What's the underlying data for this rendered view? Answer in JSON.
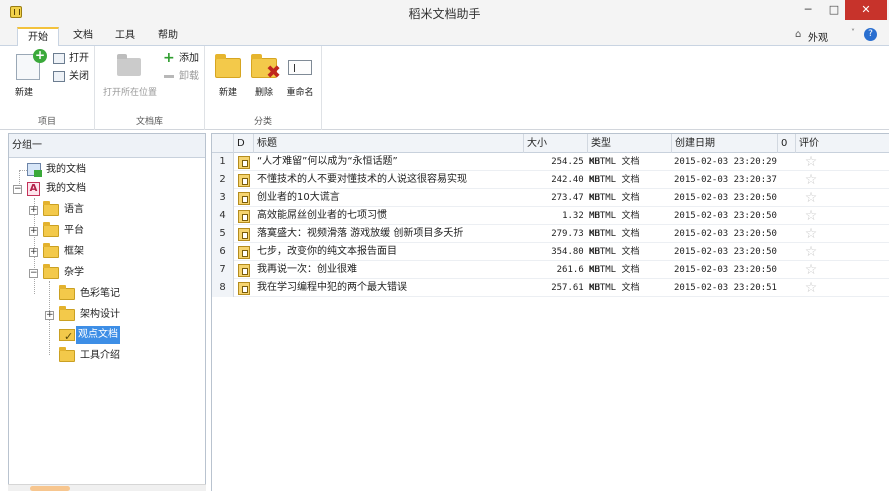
{
  "app": {
    "title": "稻米文档助手"
  },
  "window": {
    "minimize": "─",
    "maximize": "□",
    "close": "✕"
  },
  "tabs": [
    {
      "label": "开始",
      "active": true
    },
    {
      "label": "文档"
    },
    {
      "label": "工具"
    },
    {
      "label": "帮助"
    }
  ],
  "skin": {
    "icon": "⌂",
    "label": "外观",
    "arrow": "˅",
    "help": "?"
  },
  "ribbon": {
    "project": {
      "label": "项目",
      "new": "新建",
      "open": "打开",
      "close": "关闭"
    },
    "library": {
      "label": "文档库",
      "open_location": "打开所在位置",
      "add": "添加",
      "remove": "卸载"
    },
    "category": {
      "label": "分类",
      "new": "新建",
      "delete": "删除",
      "rename": "重命名"
    }
  },
  "tree": {
    "header": "分组一",
    "items": [
      {
        "label": "我的文档"
      },
      {
        "label": "我的文档"
      },
      {
        "label": "语言"
      },
      {
        "label": "平台"
      },
      {
        "label": "框架"
      },
      {
        "label": "杂学"
      },
      {
        "label": "色彩笔记"
      },
      {
        "label": "架构设计"
      },
      {
        "label": "观点文档",
        "selected": true
      },
      {
        "label": "工具介绍"
      }
    ]
  },
  "table": {
    "columns": {
      "icon": "D",
      "title": "标题",
      "size": "大小",
      "type": "类型",
      "date": "创建日期",
      "flag": "0",
      "rating": "评价"
    },
    "rows": [
      {
        "num": "1",
        "title": "“人才难留”何以成为“永恒话题”",
        "size": "254.25 KB",
        "type": "MHTML 文档",
        "date": "2015-02-03 23:20:29"
      },
      {
        "num": "2",
        "title": "不懂技术的人不要对懂技术的人说这很容易实现",
        "size": "242.40 KB",
        "type": "MHTML 文档",
        "date": "2015-02-03 23:20:37"
      },
      {
        "num": "3",
        "title": "创业者的10大谎言",
        "size": "273.47 KB",
        "type": "MHTML 文档",
        "date": "2015-02-03 23:20:50"
      },
      {
        "num": "4",
        "title": "高效能屌丝创业者的七项习惯",
        "size": "1.32 MB",
        "type": "MHTML 文档",
        "date": "2015-02-03 23:20:50"
      },
      {
        "num": "5",
        "title": "落寞盛大：视频滑落 游戏放缓 创新项目多夭折",
        "size": "279.73 KB",
        "type": "MHTML 文档",
        "date": "2015-02-03 23:20:50"
      },
      {
        "num": "6",
        "title": "七步，改变你的纯文本报告面目",
        "size": "354.80 KB",
        "type": "MHTML 文档",
        "date": "2015-02-03 23:20:50"
      },
      {
        "num": "7",
        "title": "我再说一次：创业很难",
        "size": "261.6 KB",
        "type": "MHTML 文档",
        "date": "2015-02-03 23:20:50"
      },
      {
        "num": "8",
        "title": "我在学习编程中犯的两个最大错误",
        "size": "257.61 KB",
        "type": "MHTML 文档",
        "date": "2015-02-03 23:20:51"
      }
    ],
    "star": "☆"
  }
}
